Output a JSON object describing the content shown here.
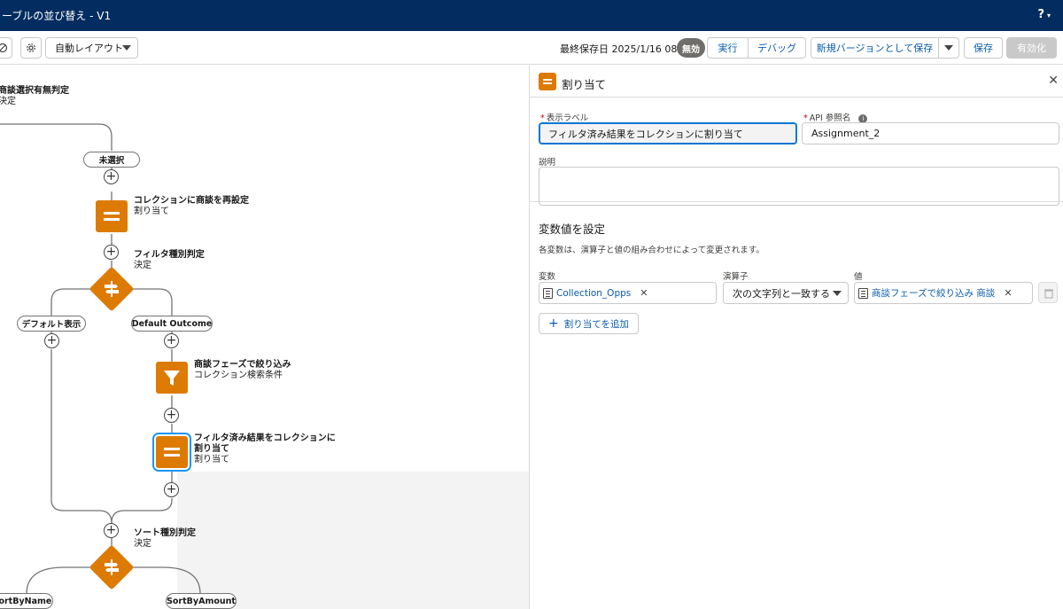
{
  "window": {
    "title": "ーブルの並び替え - V1",
    "help_label": "?",
    "help_caret": "▾"
  },
  "toolbar": {
    "layout_select": "自動レイアウト",
    "last_saved": "最終保存日 2025/1/16 08:55",
    "status_badge": "無効",
    "run": "実行",
    "debug": "デバッグ",
    "save_new_version": "新規バージョンとして保存",
    "save": "保存",
    "activate": "有効化"
  },
  "canvas": {
    "top_decision": {
      "title": "商談選択有無判定",
      "type": "決定"
    },
    "unselected_outcome": "未選択",
    "assign1": {
      "title": "コレクションに商談を再設定",
      "type": "割り当て"
    },
    "filter_decision": {
      "title": "フィルタ種別判定",
      "type": "決定"
    },
    "default_display": "デフォルト表示",
    "default_outcome": "Default Outcome",
    "filter_node": {
      "title": "商談フェーズで絞り込み",
      "type": "コレクション検索条件"
    },
    "assign2": {
      "title_line1": "フィルタ済み結果をコレクションに",
      "title_line2": "割り当て",
      "type": "割り当て"
    },
    "sort_decision": {
      "title": "ソート種別判定",
      "type": "決定"
    },
    "sort_by_name": "SortByName",
    "sort_by_amount": "SortByAmount"
  },
  "panel": {
    "title": "割り当て",
    "label_field": {
      "label": "表示ラベル",
      "value": "フィルタ済み結果をコレクションに割り当て"
    },
    "api_field": {
      "label": "API 参照名",
      "value": "Assignment_2"
    },
    "description_label": "説明",
    "section_title": "変数値を設定",
    "section_desc": "各変数は、演算子と値の組み合わせによって変更されます。",
    "row": {
      "variable_label": "変数",
      "operator_label": "演算子",
      "value_label": "値",
      "variable": "Collection_Opps",
      "operator": "次の文字列と一致する",
      "value": "商談フェーズで絞り込み 商談"
    },
    "add_assignment": "割り当てを追加"
  }
}
